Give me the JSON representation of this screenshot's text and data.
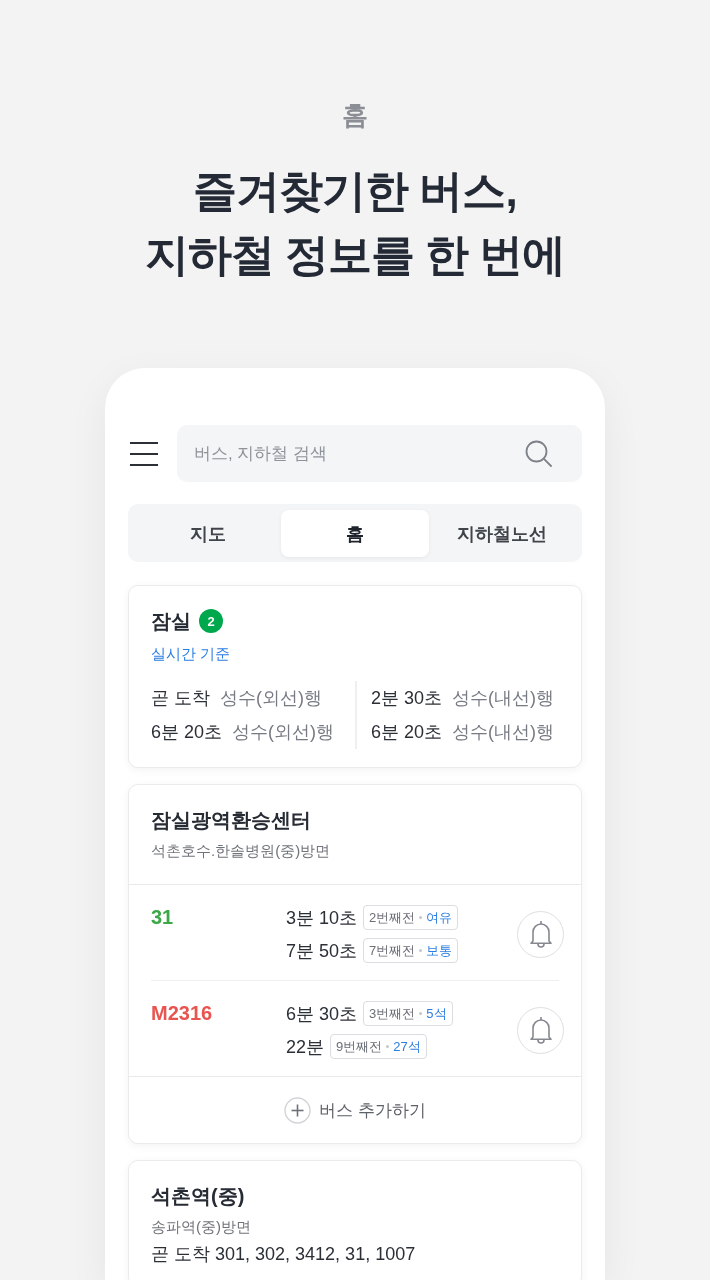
{
  "header": {
    "section_label": "홈",
    "headline": "즐겨찾기한 버스,\n지하철 정보를 한 번에"
  },
  "app": {
    "search": {
      "placeholder": "버스, 지하철 검색"
    },
    "tabs": [
      {
        "label": "지도",
        "selected": false
      },
      {
        "label": "홈",
        "selected": true
      },
      {
        "label": "지하철노선",
        "selected": false
      }
    ],
    "cards": [
      {
        "kind": "subway",
        "title": "잠실",
        "line": {
          "label": "2",
          "color": "#00a84d"
        },
        "note": "실시간 기준",
        "columns": [
          [
            {
              "time": "곧 도착",
              "destination": "성수(외선)행"
            },
            {
              "time": "6분 20초",
              "destination": "성수(외선)행"
            }
          ],
          [
            {
              "time": "2분 30초",
              "destination": "성수(내선)행"
            },
            {
              "time": "6분 20초",
              "destination": "성수(내선)행"
            }
          ]
        ]
      },
      {
        "kind": "bus_stop",
        "title": "잠실광역환승센터",
        "direction": "석촌호수.한솔병원(중)방면",
        "buses": [
          {
            "number": "31",
            "color": "#3aa846",
            "arrivals": [
              {
                "time": "3분 10초",
                "stops": "2번째전",
                "status": "여유"
              },
              {
                "time": "7분 50초",
                "stops": "7번째전",
                "status": "보통"
              }
            ]
          },
          {
            "number": "M2316",
            "color": "#e8544f",
            "arrivals": [
              {
                "time": "6분 30초",
                "stops": "3번째전",
                "status": "5석"
              },
              {
                "time": "22분",
                "stops": "9번째전",
                "status": "27석"
              }
            ]
          }
        ],
        "add_label": "버스 추가하기"
      },
      {
        "kind": "bus_stop_summary",
        "title": "석촌역(중)",
        "direction": "송파역(중)방면",
        "summary": "곧 도착 301, 302, 3412, 31, 1007"
      }
    ]
  }
}
